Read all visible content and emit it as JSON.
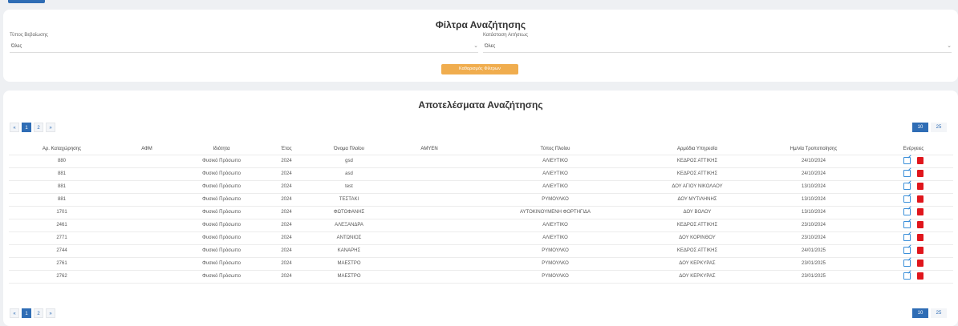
{
  "filters": {
    "title": "Φίλτρα Αναζήτησης",
    "field1_label": "Τύπος Βεβαίωσης",
    "field1_value": "Όλες",
    "field2_label": "Κατάσταση Αιτήσεως",
    "field2_value": "Όλες",
    "clear_label": "Καθαρισμός Φίλτρων"
  },
  "results": {
    "title": "Αποτελέσματα Αναζήτησης",
    "pager": {
      "prev": "«",
      "pages": [
        "1",
        "2"
      ],
      "next": "»"
    },
    "sizes": [
      "10",
      "25"
    ],
    "columns": [
      "Αρ. Καταχώρησης",
      "ΑΦΜ",
      "Ιδιότητα",
      "Έτος",
      "Όνομα Πλοίου",
      "ΑΜΥΕΝ",
      "Τύπος Πλοίου",
      "Αρμόδια Υπηρεσία",
      "Ημ/νία Τροποποίησης",
      "Ενέργειες"
    ],
    "rows": [
      [
        "880",
        "",
        "Φυσικό Πρόσωπο",
        "2024",
        "gsd",
        "",
        "ΑΛΙΕΥΤΙΚΟ",
        "ΚΕΔΡΟΣ ΑΤΤΙΚΗΣ",
        "24/10/2024"
      ],
      [
        "881",
        "",
        "Φυσικό Πρόσωπο",
        "2024",
        "asd",
        "",
        "ΑΛΙΕΥΤΙΚΟ",
        "ΚΕΔΡΟΣ ΑΤΤΙΚΗΣ",
        "24/10/2024"
      ],
      [
        "881",
        "",
        "Φυσικό Πρόσωπο",
        "2024",
        "test",
        "",
        "ΑΛΙΕΥΤΙΚΟ",
        "ΔΟΥ ΑΓΙΟΥ ΝΙΚΟΛΑΟΥ",
        "13/10/2024"
      ],
      [
        "881",
        "",
        "Φυσικό Πρόσωπο",
        "2024",
        "ΤΕΣΤΑΚΙ",
        "",
        "ΡΥΜΟΥΛΚΟ",
        "ΔΟΥ ΜΥΤΙΛΗΝΗΣ",
        "13/10/2024"
      ],
      [
        "1701",
        "",
        "Φυσικό Πρόσωπο",
        "2024",
        "ΦΩΤΟΦΑΝΗΣ",
        "",
        "ΑΥΤΟΚΙΝΟΥΜΕΝΗ ΦΟΡΤΗΓΙΔΑ",
        "ΔΟΥ ΒΟΛΟΥ",
        "13/10/2024"
      ],
      [
        "2461",
        "",
        "Φυσικό Πρόσωπο",
        "2024",
        "ΑΛΕΞΑΝΔΡΑ",
        "",
        "ΑΛΙΕΥΤΙΚΟ",
        "ΚΕΔΡΟΣ ΑΤΤΙΚΗΣ",
        "23/10/2024"
      ],
      [
        "2771",
        "",
        "Φυσικό Πρόσωπο",
        "2024",
        "ΑΝΤΩΝΙΟΣ",
        "",
        "ΑΛΙΕΥΤΙΚΟ",
        "ΔΟΥ ΚΟΡΙΝΘΟΥ",
        "23/10/2024"
      ],
      [
        "2744",
        "",
        "Φυσικό Πρόσωπο",
        "2024",
        "ΚΑΝΑΡΗΣ",
        "",
        "ΡΥΜΟΥΛΚΟ",
        "ΚΕΔΡΟΣ ΑΤΤΙΚΗΣ",
        "24/01/2025"
      ],
      [
        "2761",
        "",
        "Φυσικό Πρόσωπο",
        "2024",
        "ΜΑΕΣΤΡΟ",
        "",
        "ΡΥΜΟΥΛΚΟ",
        "ΔΟΥ ΚΕΡΚΥΡΑΣ",
        "23/01/2025"
      ],
      [
        "2762",
        "",
        "Φυσικό Πρόσωπο",
        "2024",
        "ΜΑΕΣΤΡΟ",
        "",
        "ΡΥΜΟΥΛΚΟ",
        "ΔΟΥ ΚΕΡΚΥΡΑΣ",
        "23/01/2025"
      ]
    ]
  },
  "colors": {
    "primary": "#2f6db5",
    "warning": "#f0ad4e",
    "danger": "#e0161c"
  },
  "icons": {
    "edit": "edit-icon",
    "delete": "delete-icon"
  }
}
